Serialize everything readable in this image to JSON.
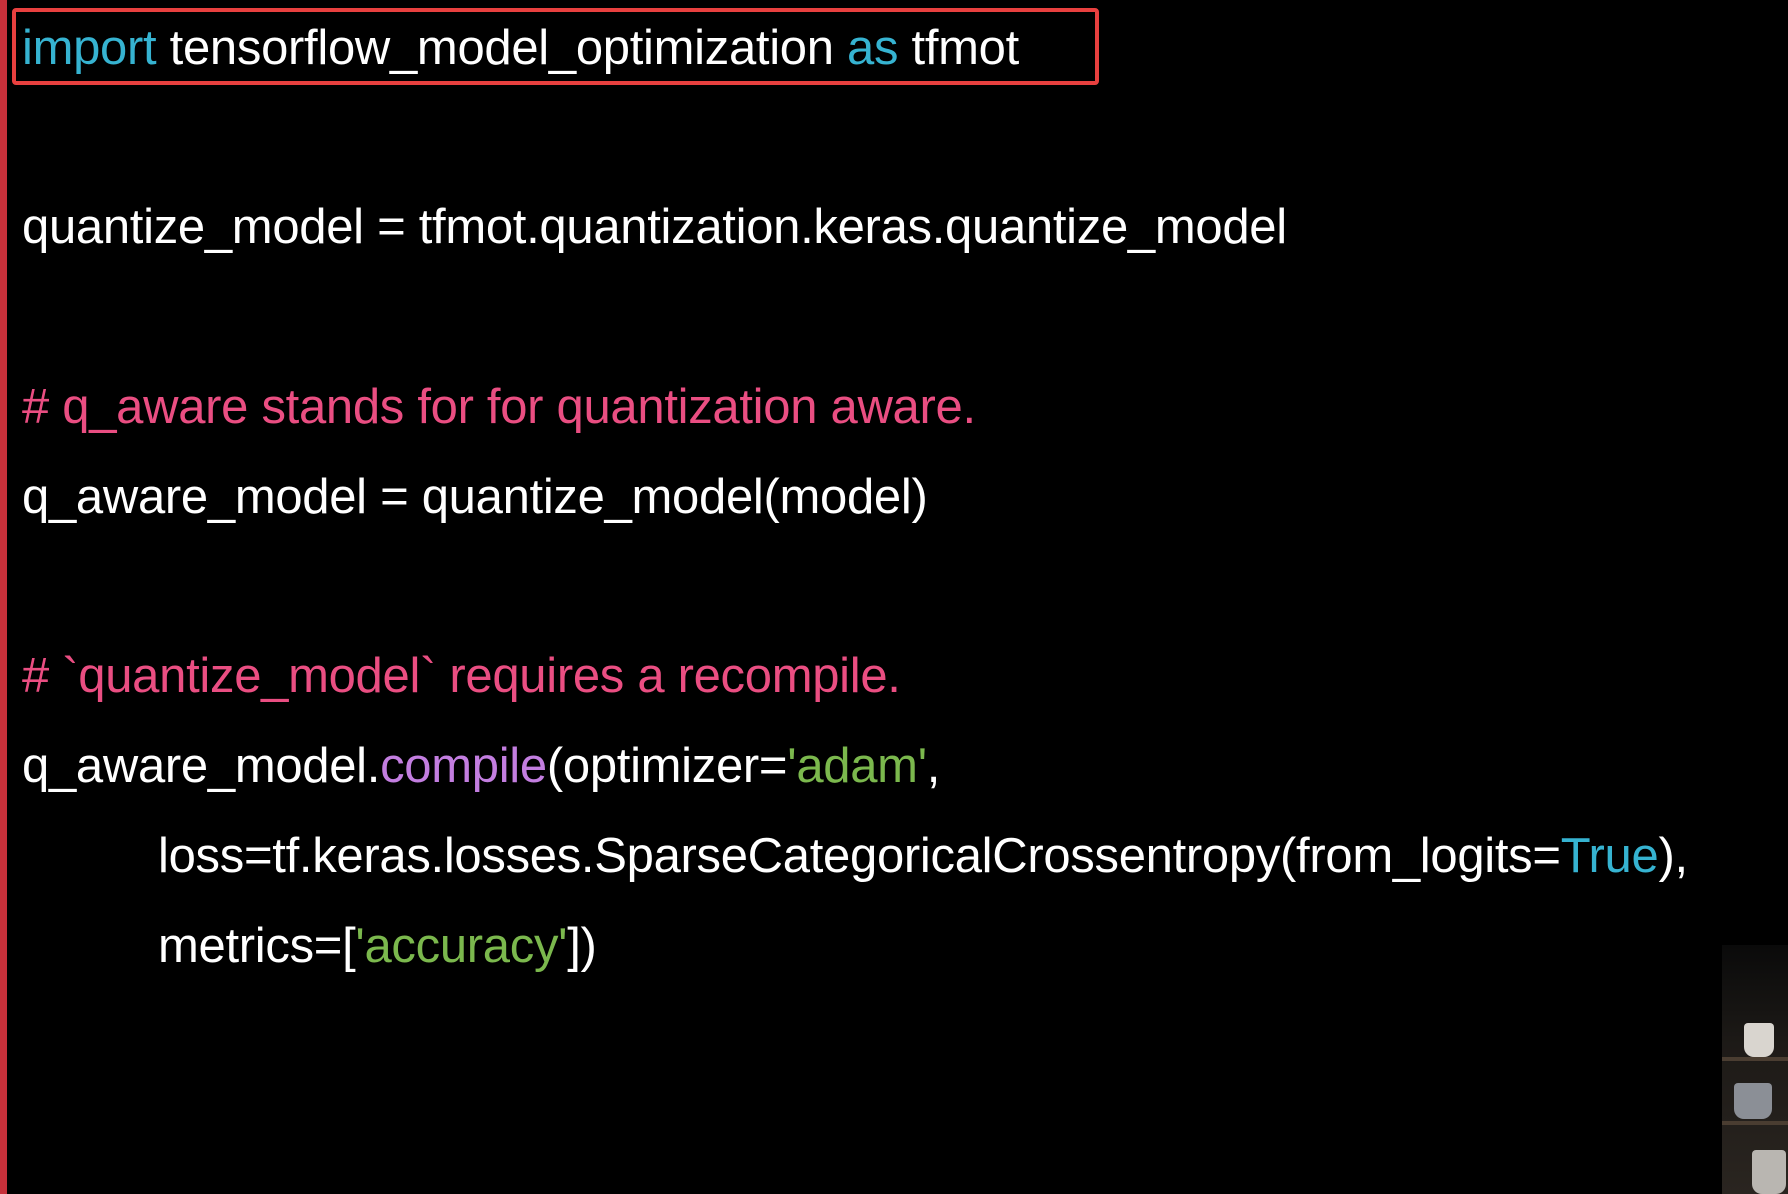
{
  "code": {
    "lines": [
      {
        "kind": "import",
        "tokens": [
          "import",
          " tensorflow_model_optimization ",
          "as",
          " tfmot"
        ]
      },
      {
        "kind": "assign",
        "text": "quantize_model = tfmot.quantization.keras.quantize_model"
      },
      {
        "kind": "comment",
        "text": "# q_aware stands for for quantization aware."
      },
      {
        "kind": "assign",
        "text": "q_aware_model = quantize_model(model)"
      },
      {
        "kind": "comment",
        "text": "# `quantize_model` requires a recompile."
      },
      {
        "kind": "call",
        "tokens": [
          "q_aware_model.",
          "compile",
          "(optimizer=",
          "'adam'",
          ","
        ]
      },
      {
        "kind": "arg",
        "tokens": [
          "loss=tf.keras.losses.SparseCategoricalCrossentropy(from_logits=",
          "True",
          "),"
        ]
      },
      {
        "kind": "arg",
        "tokens": [
          "metrics=[",
          "'accuracy'",
          "])"
        ]
      }
    ]
  },
  "colors": {
    "background": "#000000",
    "text": "#ffffff",
    "keyword": "#36b3d1",
    "comment": "#ea4e82",
    "function": "#c37ee0",
    "string": "#7bb84d",
    "highlight_border": "#e8403f",
    "left_bar": "#c7303a"
  },
  "highlight": {
    "target_line": "import tensorflow_model_optimization as tfmot"
  },
  "decor": {
    "webcam_thumbnail": "shelf-with-mugs-image"
  }
}
